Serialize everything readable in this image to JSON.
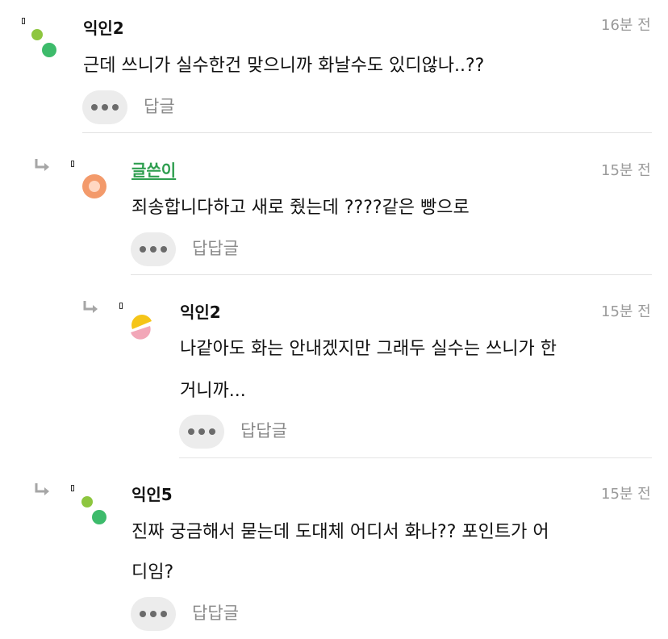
{
  "comments": [
    {
      "author": "익인2",
      "time": "16분 전",
      "lines": [
        "근데 쓰니가 실수한건 맞으니까 화날수도 있디않나..??"
      ],
      "reply_label": "답글",
      "avatar_colors": [
        "#8dc63f",
        "#3dbb6b"
      ]
    },
    {
      "author": "글쓴이",
      "time": "15분 전",
      "lines": [
        "죄송합니다하고 새로 줬는데 ????같은 빵으로"
      ],
      "reply_label": "답답글",
      "avatar_colors": [
        "#f39a6b",
        "#ffd7c2"
      ]
    },
    {
      "author": "익인2",
      "time": "15분 전",
      "lines": [
        "나같아도 화는 안내겠지만 그래두 실수는 쓰니가 한",
        "거니까..."
      ],
      "reply_label": "답답글",
      "avatar_colors": [
        "#f5c518",
        "#f2a7b8"
      ]
    },
    {
      "author": "익인5",
      "time": "15분 전",
      "lines": [
        "진짜 궁금해서 묻는데 도대체 어디서 화나?? 포인트가 어",
        "디임?"
      ],
      "reply_label": "답답글",
      "avatar_colors": [
        "#8dc63f",
        "#3dbb6b"
      ]
    }
  ],
  "icons": {
    "reply_arrow": "reply-arrow-icon",
    "more": "more-dots-icon"
  },
  "colors": {
    "writer_name": "#2e9e4f",
    "time": "#9a9a9a",
    "divider": "#e3e3e3"
  }
}
